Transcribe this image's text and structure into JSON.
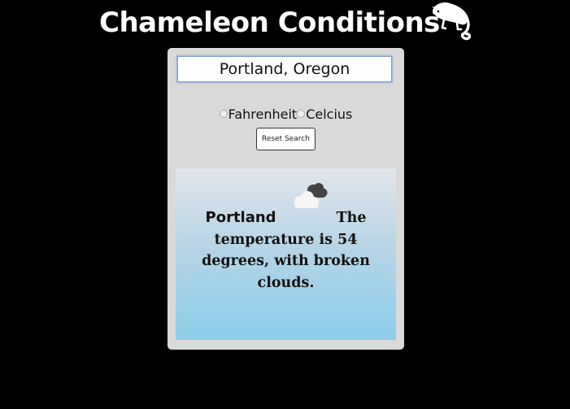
{
  "header": {
    "title": "Chameleon Conditions",
    "logo_icon": "chameleon-icon"
  },
  "search": {
    "value": "Portland, Oregon"
  },
  "units": {
    "options": [
      "Fahrenheit",
      "Celcius"
    ]
  },
  "reset_label": "Reset Search",
  "weather": {
    "city": "Portland",
    "description": "The temperature is 54 degrees, with broken clouds.",
    "icon": "broken-clouds-icon"
  },
  "colors": {
    "background": "#000000",
    "panel": "#d9d9d9",
    "card_gradient_top": "#e2e6ea",
    "card_gradient_bottom": "#8ccdea",
    "title": "#ffffff"
  }
}
